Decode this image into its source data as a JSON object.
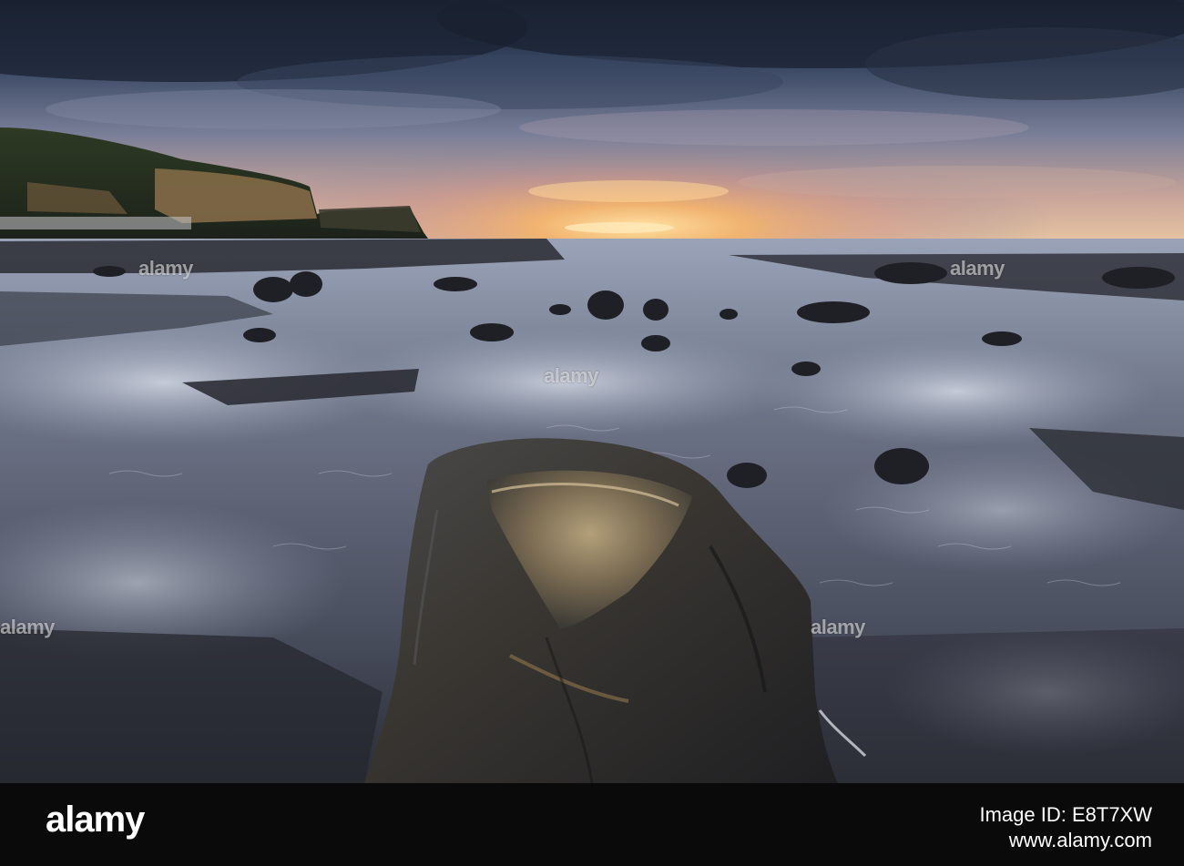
{
  "watermark": {
    "text": "alamy"
  },
  "footer": {
    "brand": "alamy",
    "image_id_line1": "Image ID: E8T7XW",
    "image_id_line2": "www.alamy.com"
  },
  "colors": {
    "sky_dark": "#1f2a3d",
    "sky_mid": "#4a5a78",
    "sunset": "#f2b56b",
    "rock": "#2a2a2c",
    "wet_sand": "#8a93a6",
    "footer_bg": "#0a0a0a"
  }
}
